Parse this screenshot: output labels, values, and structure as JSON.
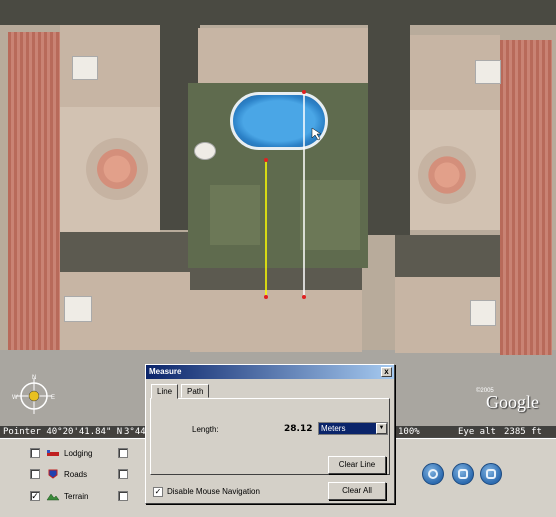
{
  "status_bar": {
    "pointer": "Pointer 40°20'41.84\" N",
    "pointer_lon": "3°44",
    "zoom_pct": "100%",
    "eye_alt": "Eye alt",
    "eye_alt_value": "2385 ft"
  },
  "map": {
    "logo": "Google",
    "copyright": "©2005"
  },
  "dialog": {
    "title": "Measure",
    "close": "x",
    "tabs": [
      {
        "label": "Line",
        "active": true
      },
      {
        "label": "Path",
        "active": false
      }
    ],
    "length_label": "Length:",
    "length_value": "28.12",
    "unit": "Meters",
    "clear_line": "Clear Line",
    "clear_all": "Clear All",
    "disable_nav": "Disable Mouse Navigation",
    "disable_nav_checked": true
  },
  "layers": [
    {
      "label": "Lodging",
      "checked": false,
      "icon": "bed-icon"
    },
    {
      "label": "Roads",
      "checked": false,
      "icon": "road-shield-icon"
    },
    {
      "label": "Terrain",
      "checked": true,
      "icon": "mountain-icon"
    }
  ],
  "colors": {
    "measure_line_yellow": "#ffff00",
    "measure_line_white": "#ffffff",
    "endpoint": "#e02020",
    "titlebar": "#0a246a"
  },
  "icons": {
    "compass": "compass-icon",
    "nav_buttons": [
      "rotate-icon",
      "tilt-icon",
      "zoom-icon"
    ]
  }
}
